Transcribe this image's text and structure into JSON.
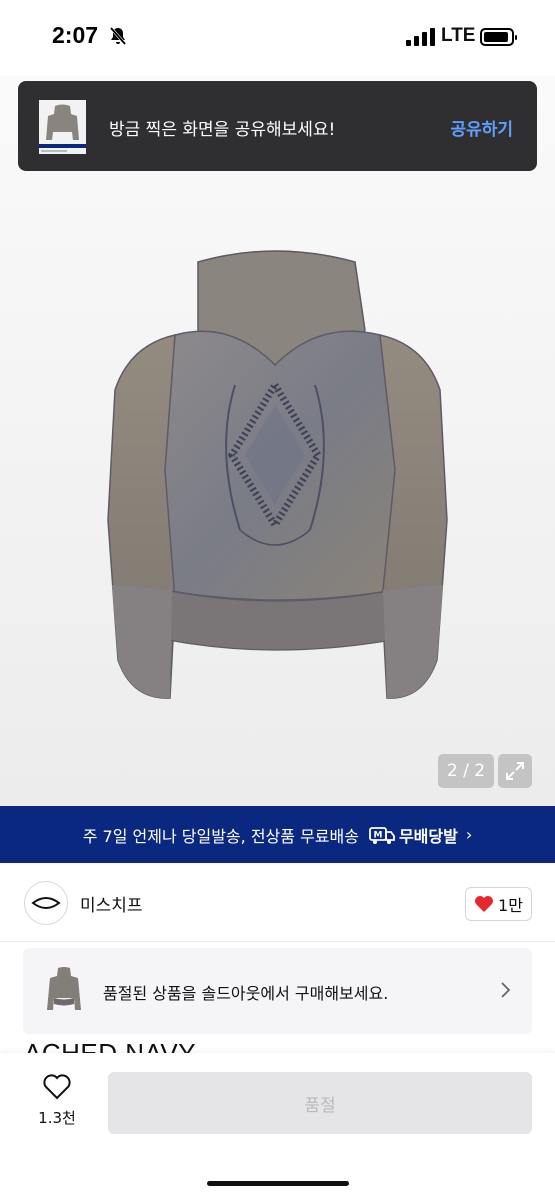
{
  "status_bar": {
    "time": "2:07",
    "network": "LTE"
  },
  "share_toast": {
    "message": "방금 찍은 화면을 공유해보세요!",
    "action": "공유하기"
  },
  "gallery": {
    "counter": "2 / 2"
  },
  "shipping_banner": {
    "text": "주 7일 언제나 당일발송, 전상품 무료배송",
    "badge": "무배당발",
    "badge_icon_letter": "M"
  },
  "seller": {
    "name": "미스치프",
    "likes": "1만"
  },
  "soldout_card": {
    "text": "품절된 상품을 솔드아웃에서 구매해보세요."
  },
  "product": {
    "title_partial": "ACHED NAVY"
  },
  "bottom_bar": {
    "wish_count": "1.3천",
    "buy_label": "품절"
  },
  "colors": {
    "toast_bg": "#2f2f31",
    "toast_action": "#5fa0ff",
    "banner_bg": "#0b2880",
    "heart": "#e8282f",
    "soldout_button_bg": "#e5e5e7"
  }
}
